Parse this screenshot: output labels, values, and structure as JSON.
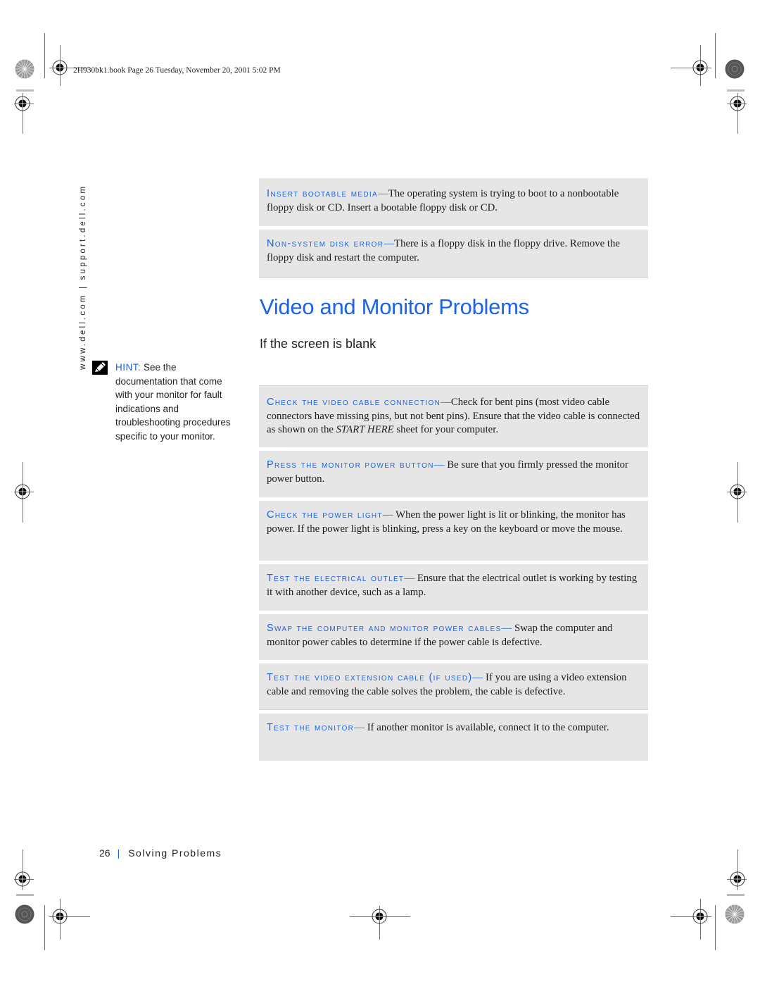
{
  "page": {
    "book_header": "2H930bk1.book  Page 26  Tuesday, November 20, 2001  5:02 PM",
    "side_url": "www.dell.com | support.dell.com",
    "title": "Video and Monitor Problems",
    "subheading": "If the screen is blank",
    "accent_color": "#1a63e6",
    "box_color": "#e6e6e6"
  },
  "hint": {
    "icon": "pencil-note-icon",
    "label": "HINT:",
    "text": "See the documentation that come with your monitor for fault indications and troubleshooting procedures specific to your monitor."
  },
  "top_boxes": [
    {
      "term": "Insert bootable media",
      "dash": "—",
      "text": "The operating system is trying to boot to a nonbootable floppy disk or CD. Insert a bootable floppy disk or CD."
    },
    {
      "term": "Non-system disk error",
      "dash": "—",
      "text": "There is a floppy disk in the floppy drive. Remove the floppy disk and restart the computer."
    }
  ],
  "steps": [
    {
      "term": "Check the video cable connection",
      "dash": "—",
      "text_before": "Check for bent pins (most video cable connectors have missing pins, but not bent pins). Ensure that the video cable is connected as shown on the ",
      "text_italic": "START HERE",
      "text_after": " sheet for your computer."
    },
    {
      "term": "Press the monitor power button",
      "dash": "—",
      "text": " Be sure that you firmly pressed the monitor power button."
    },
    {
      "term": "Check the power light",
      "dash": "—",
      "text": " When the power light is lit or blinking, the monitor has power. If the power light is blinking, press a key on the keyboard or move the mouse."
    },
    {
      "term": "Test the electrical outlet",
      "dash": "—",
      "text": " Ensure that the electrical outlet is working by testing it with another device, such as a lamp."
    },
    {
      "term": "Swap the computer and monitor power cables",
      "dash": "—",
      "text": " Swap the computer and monitor power cables to determine if the power cable is defective."
    },
    {
      "term": "Test the video extension cable (if used)",
      "dash": "—",
      "text": " If you are using a video extension cable and removing the cable solves the problem, the cable is defective."
    },
    {
      "term": "Test the monitor",
      "dash": "—",
      "text": " If another monitor is available, connect it to the computer."
    }
  ],
  "footer": {
    "page_number": "26",
    "separator": "|",
    "section": "Solving Problems"
  },
  "print_marks": {
    "registration_icon": "registration-crosshair-icon",
    "rosette_icon": "color-rosette-icon"
  }
}
